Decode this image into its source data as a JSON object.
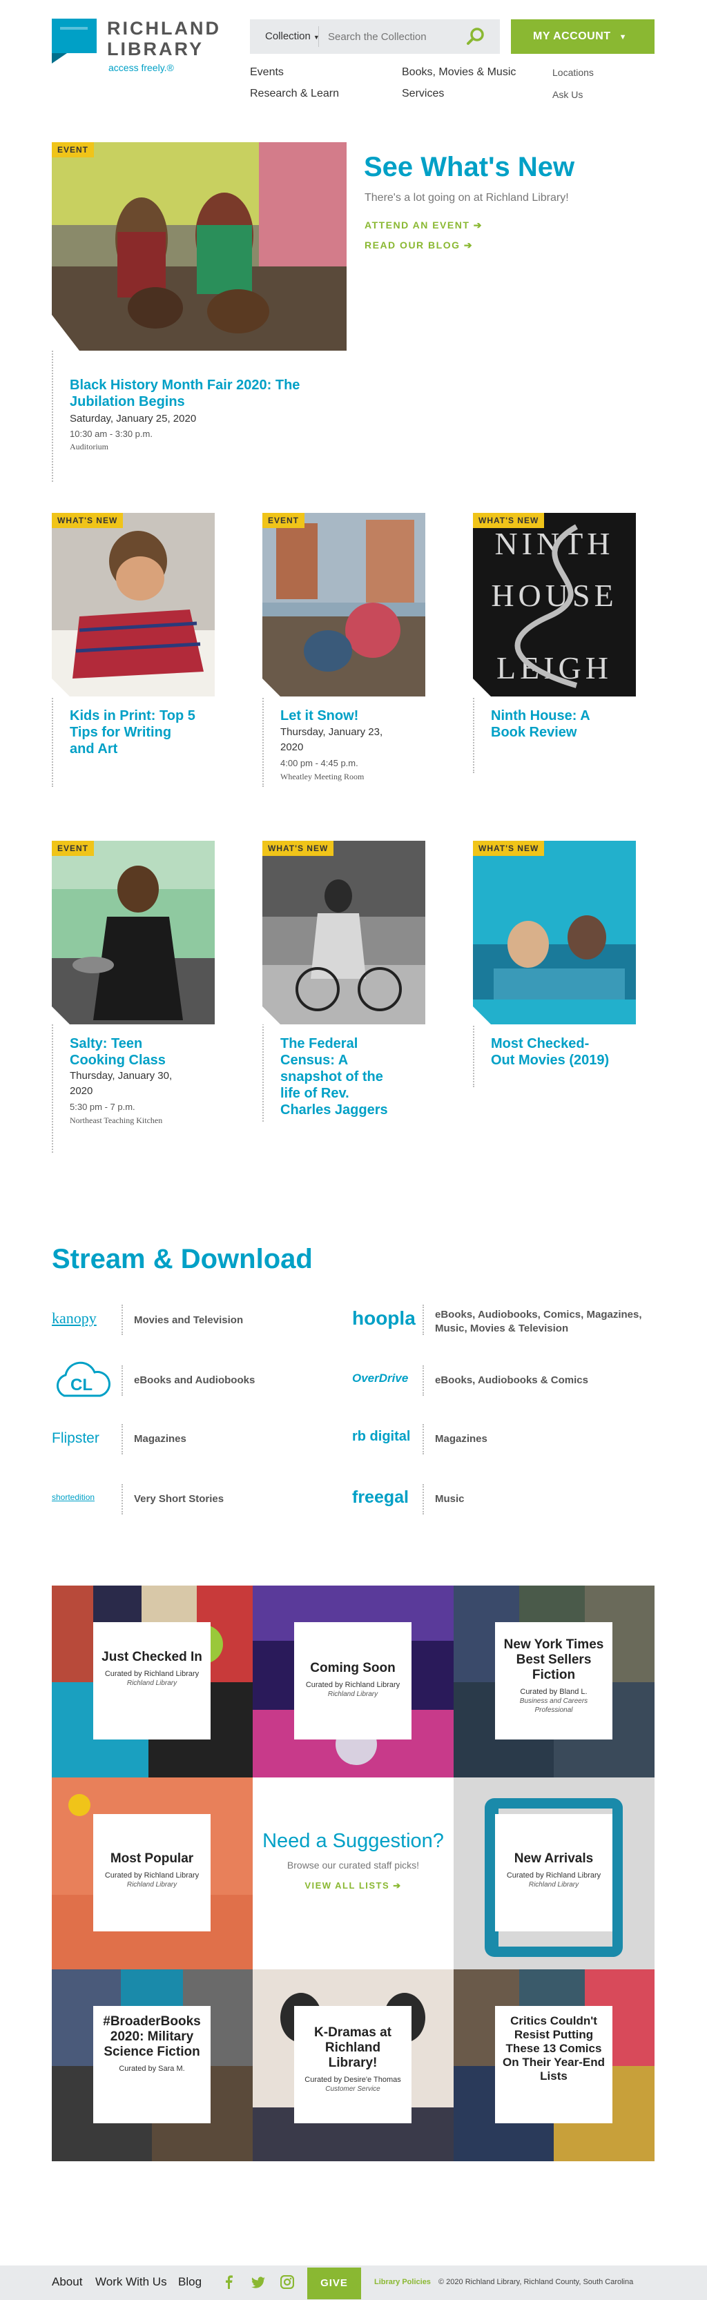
{
  "header": {
    "logo_line1": "RICHLAND",
    "logo_line2": "LIBRARY",
    "tagline": "access freely.®",
    "collection_label": "Collection",
    "search_placeholder": "Search the Collection",
    "account_label": "MY ACCOUNT",
    "nav_main": [
      "Events",
      "Research & Learn",
      "Books, Movies & Music",
      "Services"
    ],
    "nav_secondary": [
      "Locations",
      "Ask Us"
    ]
  },
  "featured": {
    "tag": "EVENT",
    "title": "Black History Month Fair 2020: The Jubilation Begins",
    "date": "Saturday, January 25, 2020",
    "time": "10:30 am - 3:30 p.m.",
    "place": "Auditorium",
    "headline": "See What's New",
    "subhead": "There's a lot going on at Richland Library!",
    "link1": "ATTEND AN EVENT",
    "link2": "READ OUR BLOG"
  },
  "cards": [
    {
      "tag": "WHAT'S NEW",
      "title": "Kids in Print: Top 5 Tips for Writing and Art",
      "date": "",
      "time": "",
      "place": ""
    },
    {
      "tag": "EVENT",
      "title": "Let it Snow!",
      "date": "Thursday, January 23, 2020",
      "time": "4:00 pm - 4:45 p.m.",
      "place": "Wheatley Meeting Room"
    },
    {
      "tag": "WHAT'S NEW",
      "title": "Ninth House: A Book Review",
      "date": "",
      "time": "",
      "place": ""
    },
    {
      "tag": "EVENT",
      "title": "Salty: Teen Cooking Class",
      "date": "Thursday, January 30, 2020",
      "time": "5:30 pm - 7 p.m.",
      "place": "Northeast Teaching Kitchen"
    },
    {
      "tag": "WHAT'S NEW",
      "title": "The Federal Census: A snapshot of the life of Rev. Charles Jaggers",
      "date": "",
      "time": "",
      "place": ""
    },
    {
      "tag": "WHAT'S NEW",
      "title": "Most Checked-Out Movies (2019)",
      "date": "",
      "time": "",
      "place": ""
    }
  ],
  "book_cover": {
    "line1": "NINTH",
    "line2": "HOUSE",
    "line3": "LEIGH"
  },
  "stream": {
    "heading": "Stream & Download",
    "services": [
      {
        "logo": "kanopy",
        "label": "Movies and Television"
      },
      {
        "logo": "hoopla",
        "label": "eBooks, Audiobooks, Comics, Magazines, Music, Movies & Television"
      },
      {
        "logo": "CL",
        "label": "eBooks and Audiobooks"
      },
      {
        "logo": "OverDrive",
        "label": "eBooks, Audiobooks & Comics"
      },
      {
        "logo": "Flipster",
        "label": "Magazines"
      },
      {
        "logo": "rb digital",
        "label": "Magazines"
      },
      {
        "logo": "shortedition",
        "label": "Very Short Stories"
      },
      {
        "logo": "freegal",
        "label": "Music"
      }
    ]
  },
  "lists": [
    {
      "title": "Just Checked In",
      "curated": "Curated by Richland Library",
      "org": "Richland Library"
    },
    {
      "title": "Coming Soon",
      "curated": "Curated by Richland Library",
      "org": "Richland Library"
    },
    {
      "title": "New York Times Best Sellers Fiction",
      "curated": "Curated by Bland L.",
      "org": "Business and Careers Professional"
    },
    {
      "title": "Most Popular",
      "curated": "Curated by Richland Library",
      "org": "Richland Library"
    },
    {
      "title": "New Arrivals",
      "curated": "Curated by Richland Library",
      "org": "Richland Library"
    },
    {
      "title": "#BroaderBooks 2020: Military Science Fiction",
      "curated": "Curated by Sara M.",
      "org": ""
    },
    {
      "title": "K-Dramas at Richland Library!",
      "curated": "Curated by Desire'e Thomas",
      "org": "Customer Service"
    },
    {
      "title": "Critics Couldn't Resist Putting These 13 Comics On Their Year-End Lists",
      "curated": "",
      "org": ""
    }
  ],
  "suggestion": {
    "title": "Need a Suggestion?",
    "sub": "Browse our curated staff picks!",
    "link": "VIEW ALL LISTS"
  },
  "footer": {
    "links": [
      "About",
      "Work With Us",
      "Blog"
    ],
    "give": "GIVE",
    "policies": "Library Policies",
    "copyright": "© 2020 Richland Library, Richland County, South Carolina"
  },
  "colors": {
    "brand_blue": "#00a0c6",
    "brand_green": "#8ab832",
    "tag_yellow": "#f0c419"
  }
}
